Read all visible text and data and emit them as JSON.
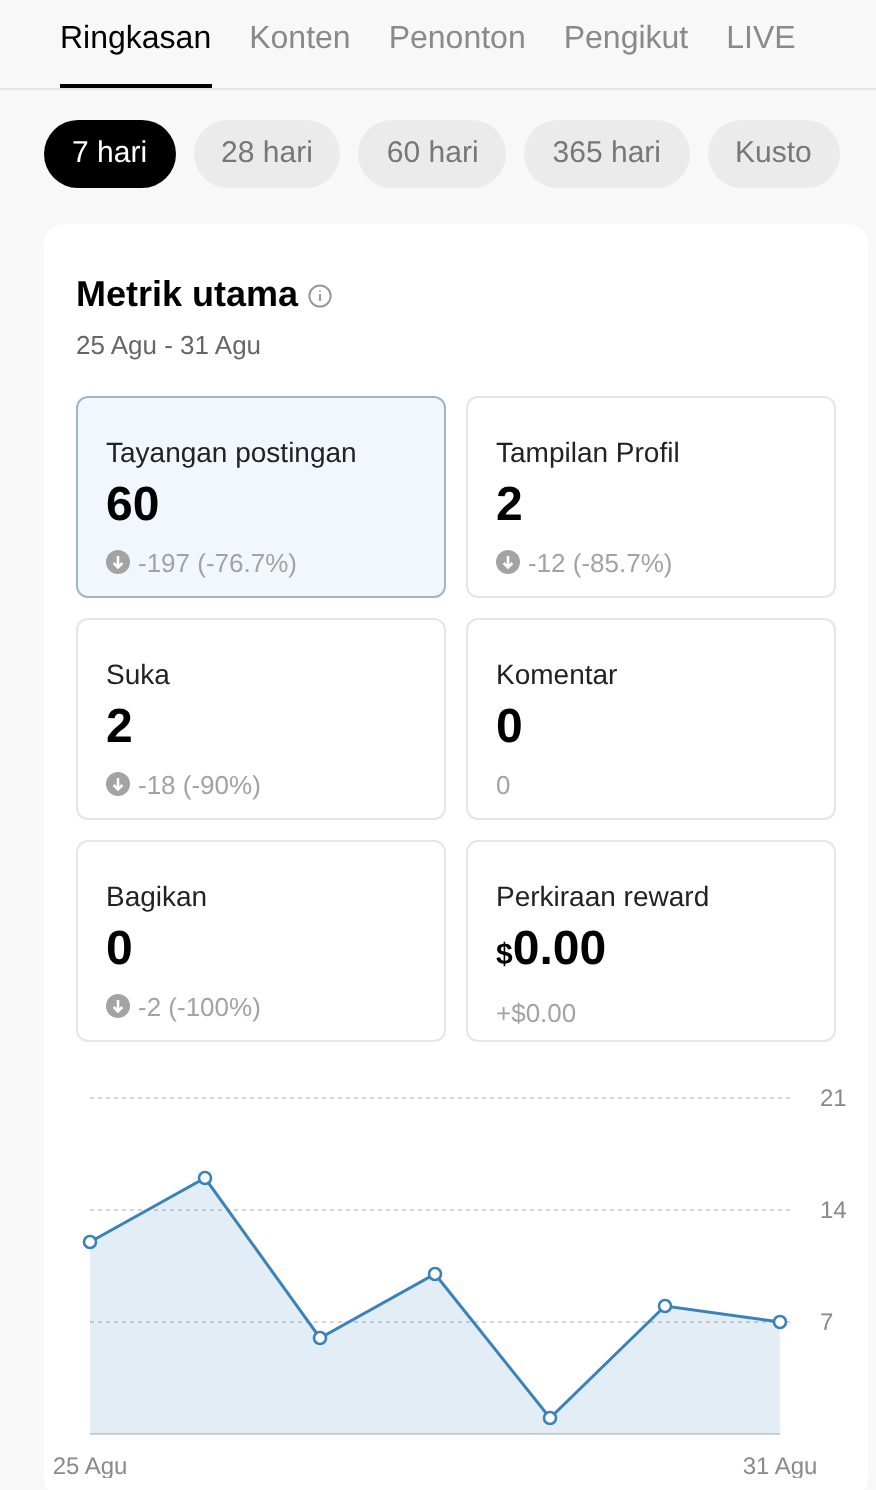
{
  "tabs": [
    {
      "label": "Ringkasan",
      "selected": true
    },
    {
      "label": "Konten",
      "selected": false
    },
    {
      "label": "Penonton",
      "selected": false
    },
    {
      "label": "Pengikut",
      "selected": false
    },
    {
      "label": "LIVE",
      "selected": false
    }
  ],
  "ranges": [
    {
      "label": "7 hari",
      "selected": true
    },
    {
      "label": "28 hari",
      "selected": false
    },
    {
      "label": "60 hari",
      "selected": false
    },
    {
      "label": "365 hari",
      "selected": false
    },
    {
      "label": "Kusto",
      "selected": false
    }
  ],
  "card": {
    "title": "Metrik utama",
    "date_range": "25 Agu - 31 Agu",
    "metrics": [
      {
        "label": "Tayangan postingan",
        "value": "60",
        "change": "-197 (-76.7%)",
        "down_icon": true,
        "selected": true
      },
      {
        "label": "Tampilan Profil",
        "value": "2",
        "change": "-12 (-85.7%)",
        "down_icon": true,
        "selected": false
      },
      {
        "label": "Suka",
        "value": "2",
        "change": "-18 (-90%)",
        "down_icon": true,
        "selected": false
      },
      {
        "label": "Komentar",
        "value": "0",
        "change": "0",
        "down_icon": false,
        "selected": false
      },
      {
        "label": "Bagikan",
        "value": "0",
        "change": "-2 (-100%)",
        "down_icon": true,
        "selected": false
      },
      {
        "label": "Perkiraan reward",
        "currency": "$",
        "value": "0.00",
        "change": "+$0.00",
        "down_icon": false,
        "selected": false
      }
    ],
    "chart_data": {
      "type": "area",
      "categories": [
        "25 Agu",
        null,
        null,
        null,
        null,
        null,
        "31 Agu"
      ],
      "series": [
        {
          "color": "#3b82b8",
          "values": [
            12,
            16,
            6,
            10,
            1,
            8,
            7
          ]
        }
      ],
      "ylim": [
        0,
        21
      ],
      "yticks": [
        7,
        14,
        21
      ]
    }
  }
}
